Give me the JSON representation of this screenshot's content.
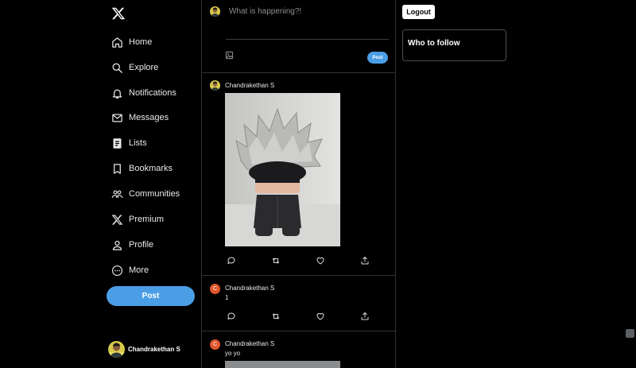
{
  "compose": {
    "placeholder": "What is happening?!",
    "post_label": "Post"
  },
  "sidebar": {
    "items": [
      {
        "label": "Home",
        "icon": "home-icon"
      },
      {
        "label": "Explore",
        "icon": "search-icon"
      },
      {
        "label": "Notifications",
        "icon": "bell-icon"
      },
      {
        "label": "Messages",
        "icon": "envelope-icon"
      },
      {
        "label": "Lists",
        "icon": "list-icon"
      },
      {
        "label": "Bookmarks",
        "icon": "bookmark-icon"
      },
      {
        "label": "Communities",
        "icon": "people-icon"
      },
      {
        "label": "Premium",
        "icon": "x-logo-icon"
      },
      {
        "label": "Profile",
        "icon": "person-icon"
      },
      {
        "label": "More",
        "icon": "more-circle-icon"
      }
    ],
    "post_label": "Post",
    "account_name": "Chandrakethan S"
  },
  "feed": {
    "tweets": [
      {
        "author": "Chandrakethan S",
        "text": "",
        "has_image": true,
        "avatar": "photo"
      },
      {
        "author": "Chandrakethan S",
        "text": "1",
        "avatar": "C"
      },
      {
        "author": "Chandrakethan S",
        "text": "yo yo",
        "avatar": "C"
      }
    ]
  },
  "right": {
    "logout_label": "Logout",
    "who_to_follow": "Who to follow"
  },
  "colors": {
    "accent": "#4b9ee6",
    "background": "#000000",
    "letter_avatar": "#e0562c"
  }
}
